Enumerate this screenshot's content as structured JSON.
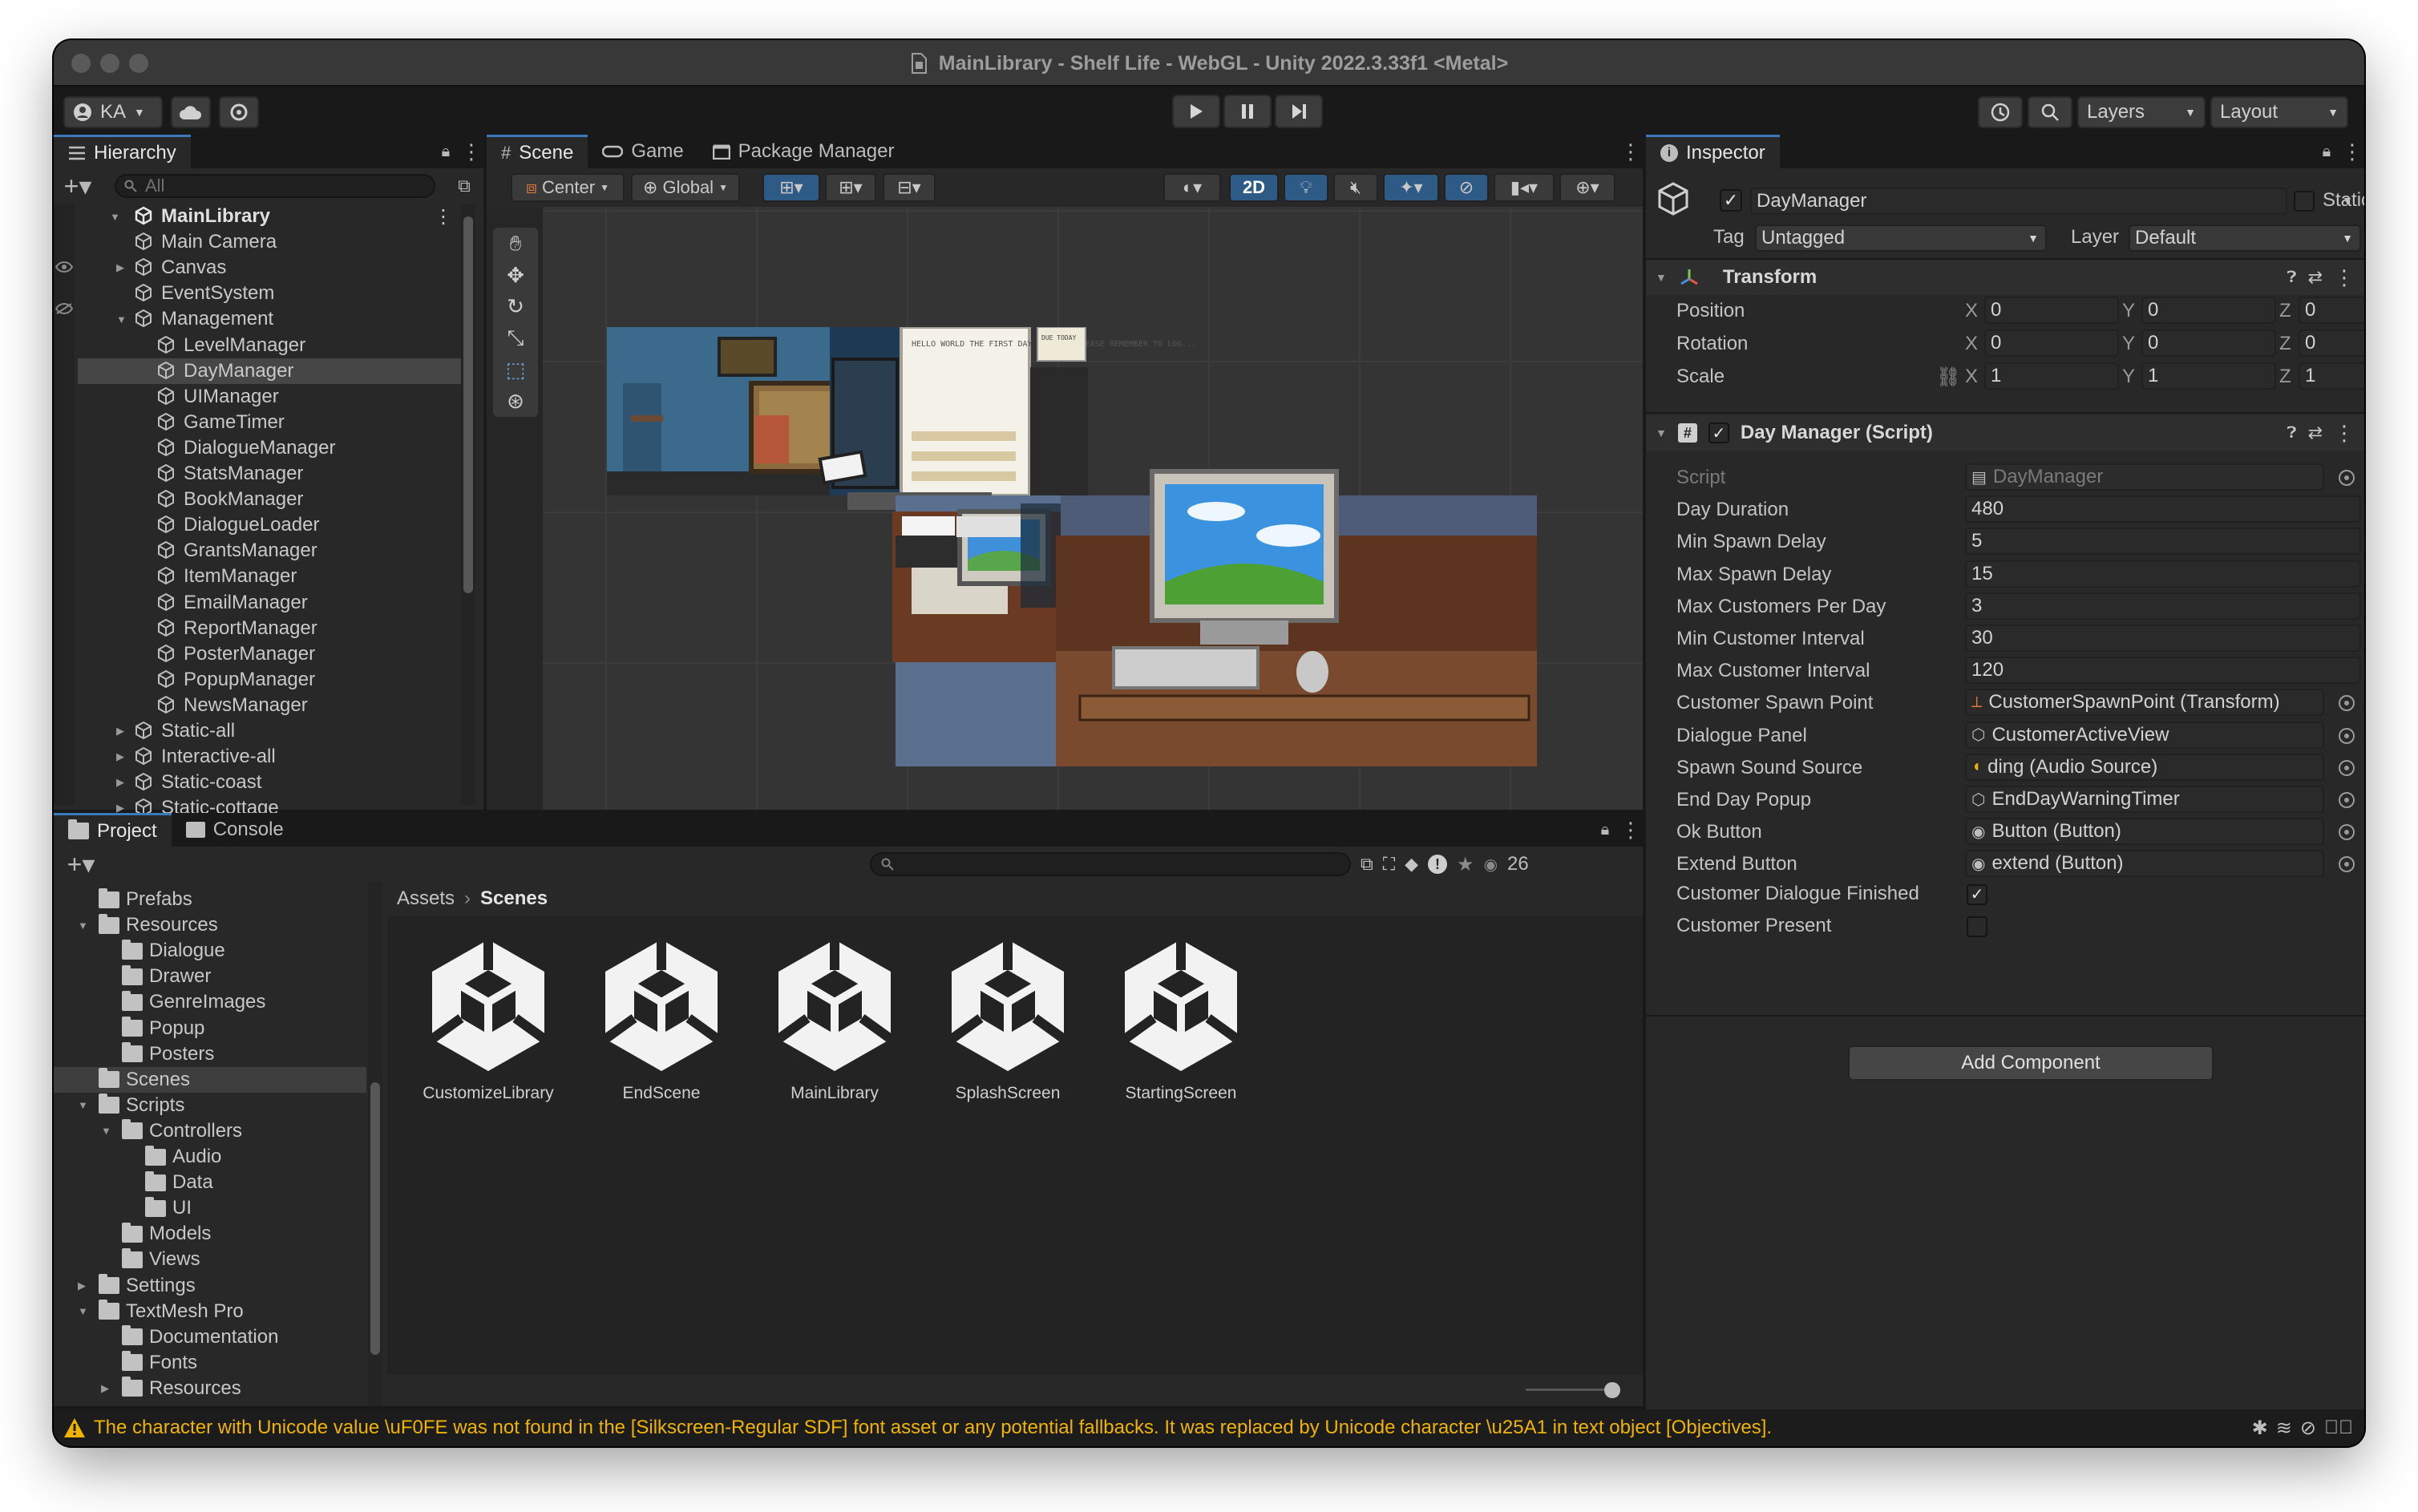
{
  "window": {
    "title": "MainLibrary - Shelf Life - WebGL - Unity 2022.3.33f1 <Metal>"
  },
  "toolbar": {
    "account": "KA",
    "layers": "Layers",
    "layout": "Layout"
  },
  "hierarchy": {
    "tab": "Hierarchy",
    "search_placeholder": "All",
    "scene_name": "MainLibrary",
    "items": [
      "Main Camera",
      "Canvas",
      "EventSystem",
      "Management",
      "LevelManager",
      "DayManager",
      "UIManager",
      "GameTimer",
      "DialogueManager",
      "StatsManager",
      "BookManager",
      "DialogueLoader",
      "GrantsManager",
      "ItemManager",
      "EmailManager",
      "ReportManager",
      "PosterManager",
      "PopupManager",
      "NewsManager",
      "Static-all",
      "Interactive-all",
      "Static-coast",
      "Static-cottage"
    ]
  },
  "scene": {
    "tabs": [
      "Scene",
      "Game",
      "Package Manager"
    ],
    "pivot": "Center",
    "space": "Global",
    "mode_2d": "2D",
    "pixel_text": {
      "memo": "HELLO WORLD THE FIRST DAY BEGINS. PLEASE REMEMBER TO LOG...",
      "note": "DUE TODAY"
    }
  },
  "inspector": {
    "tab": "Inspector",
    "object_name": "DayManager",
    "static_label": "Static",
    "tag_label": "Tag",
    "tag_value": "Untagged",
    "layer_label": "Layer",
    "layer_value": "Default",
    "transform": {
      "title": "Transform",
      "rows": [
        {
          "label": "Position",
          "x": "0",
          "y": "0",
          "z": "0"
        },
        {
          "label": "Rotation",
          "x": "0",
          "y": "0",
          "z": "0"
        },
        {
          "label": "Scale",
          "x": "1",
          "y": "1",
          "z": "1"
        }
      ]
    },
    "script": {
      "title": "Day Manager (Script)",
      "fields": [
        {
          "label": "Script",
          "value": "DayManager",
          "kind": "ref"
        },
        {
          "label": "Day Duration",
          "value": "480",
          "kind": "num"
        },
        {
          "label": "Min Spawn Delay",
          "value": "5",
          "kind": "num"
        },
        {
          "label": "Max Spawn Delay",
          "value": "15",
          "kind": "num"
        },
        {
          "label": "Max Customers Per Day",
          "value": "3",
          "kind": "num"
        },
        {
          "label": "Min Customer Interval",
          "value": "30",
          "kind": "num"
        },
        {
          "label": "Max Customer Interval",
          "value": "120",
          "kind": "num"
        },
        {
          "label": "Customer Spawn Point",
          "value": "CustomerSpawnPoint (Transform)",
          "kind": "ref"
        },
        {
          "label": "Dialogue Panel",
          "value": "CustomerActiveView",
          "kind": "ref"
        },
        {
          "label": "Spawn Sound Source",
          "value": "ding (Audio Source)",
          "kind": "ref"
        },
        {
          "label": "End Day Popup",
          "value": "EndDayWarningTimer",
          "kind": "ref"
        },
        {
          "label": "Ok Button",
          "value": "Button (Button)",
          "kind": "ref"
        },
        {
          "label": "Extend Button",
          "value": "extend (Button)",
          "kind": "ref"
        }
      ],
      "bools": [
        {
          "label": "Customer Dialogue Finished",
          "checked": true
        },
        {
          "label": "Customer Present",
          "checked": false
        }
      ]
    },
    "add_component": "Add Component"
  },
  "project": {
    "tabs": [
      "Project",
      "Console"
    ],
    "hidden_count": "26",
    "tree": [
      {
        "label": "Prefabs",
        "depth": 1
      },
      {
        "label": "Resources",
        "depth": 1,
        "open": true
      },
      {
        "label": "Dialogue",
        "depth": 2
      },
      {
        "label": "Drawer",
        "depth": 2
      },
      {
        "label": "GenreImages",
        "depth": 2
      },
      {
        "label": "Popup",
        "depth": 2
      },
      {
        "label": "Posters",
        "depth": 2
      },
      {
        "label": "Scenes",
        "depth": 1,
        "selected": true
      },
      {
        "label": "Scripts",
        "depth": 1,
        "open": true
      },
      {
        "label": "Controllers",
        "depth": 2,
        "open": true
      },
      {
        "label": "Audio",
        "depth": 3
      },
      {
        "label": "Data",
        "depth": 3
      },
      {
        "label": "UI",
        "depth": 3
      },
      {
        "label": "Models",
        "depth": 2
      },
      {
        "label": "Views",
        "depth": 2
      },
      {
        "label": "Settings",
        "depth": 1
      },
      {
        "label": "TextMesh Pro",
        "depth": 1,
        "open": true
      },
      {
        "label": "Documentation",
        "depth": 2
      },
      {
        "label": "Fonts",
        "depth": 2
      },
      {
        "label": "Resources",
        "depth": 2
      }
    ],
    "breadcrumb": [
      "Assets",
      "Scenes"
    ],
    "assets": [
      "CustomizeLibrary",
      "EndScene",
      "MainLibrary",
      "SplashScreen",
      "StartingScreen"
    ]
  },
  "status": {
    "message": "The character with Unicode value \\uF0FE was not found in the [Silkscreen-Regular SDF] font asset or any potential fallbacks. It was replaced by Unicode character \\u25A1 in text object [Objectives]."
  },
  "colors": {
    "accent": "#3a79bb",
    "warning": "#f0b400",
    "selection": "#2c5d87"
  }
}
